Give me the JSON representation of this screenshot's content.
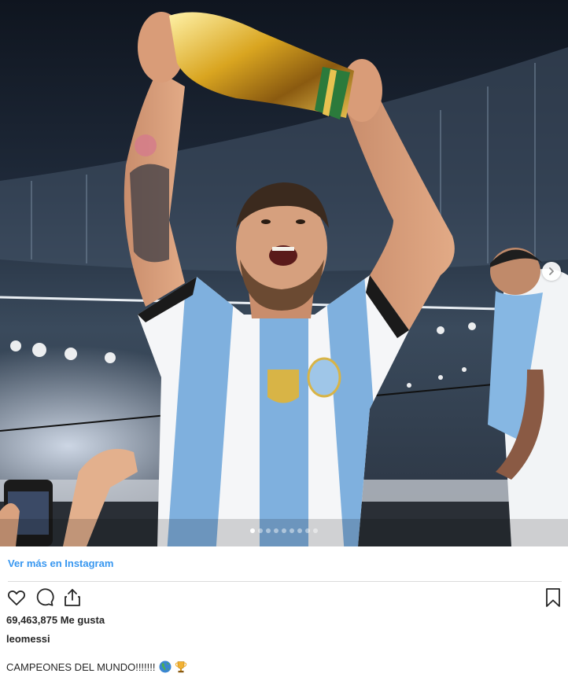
{
  "post": {
    "carousel": {
      "dot_count": 9,
      "active_index": 0
    },
    "view_more_label": "Ver más en Instagram",
    "likes": {
      "count": "69,463,875",
      "label": "Me gusta"
    },
    "username": "leomessi",
    "caption": {
      "text": "CAMPEONES DEL MUNDO!!!!!!!",
      "emojis": [
        "globe-americas-emoji",
        "trophy-emoji"
      ]
    },
    "colors": {
      "link": "#3897f0",
      "text": "#262626",
      "divider": "#dbdbdb"
    },
    "icons": [
      "heart-icon",
      "comment-icon",
      "share-icon",
      "bookmark-icon",
      "chevron-right-icon"
    ]
  }
}
